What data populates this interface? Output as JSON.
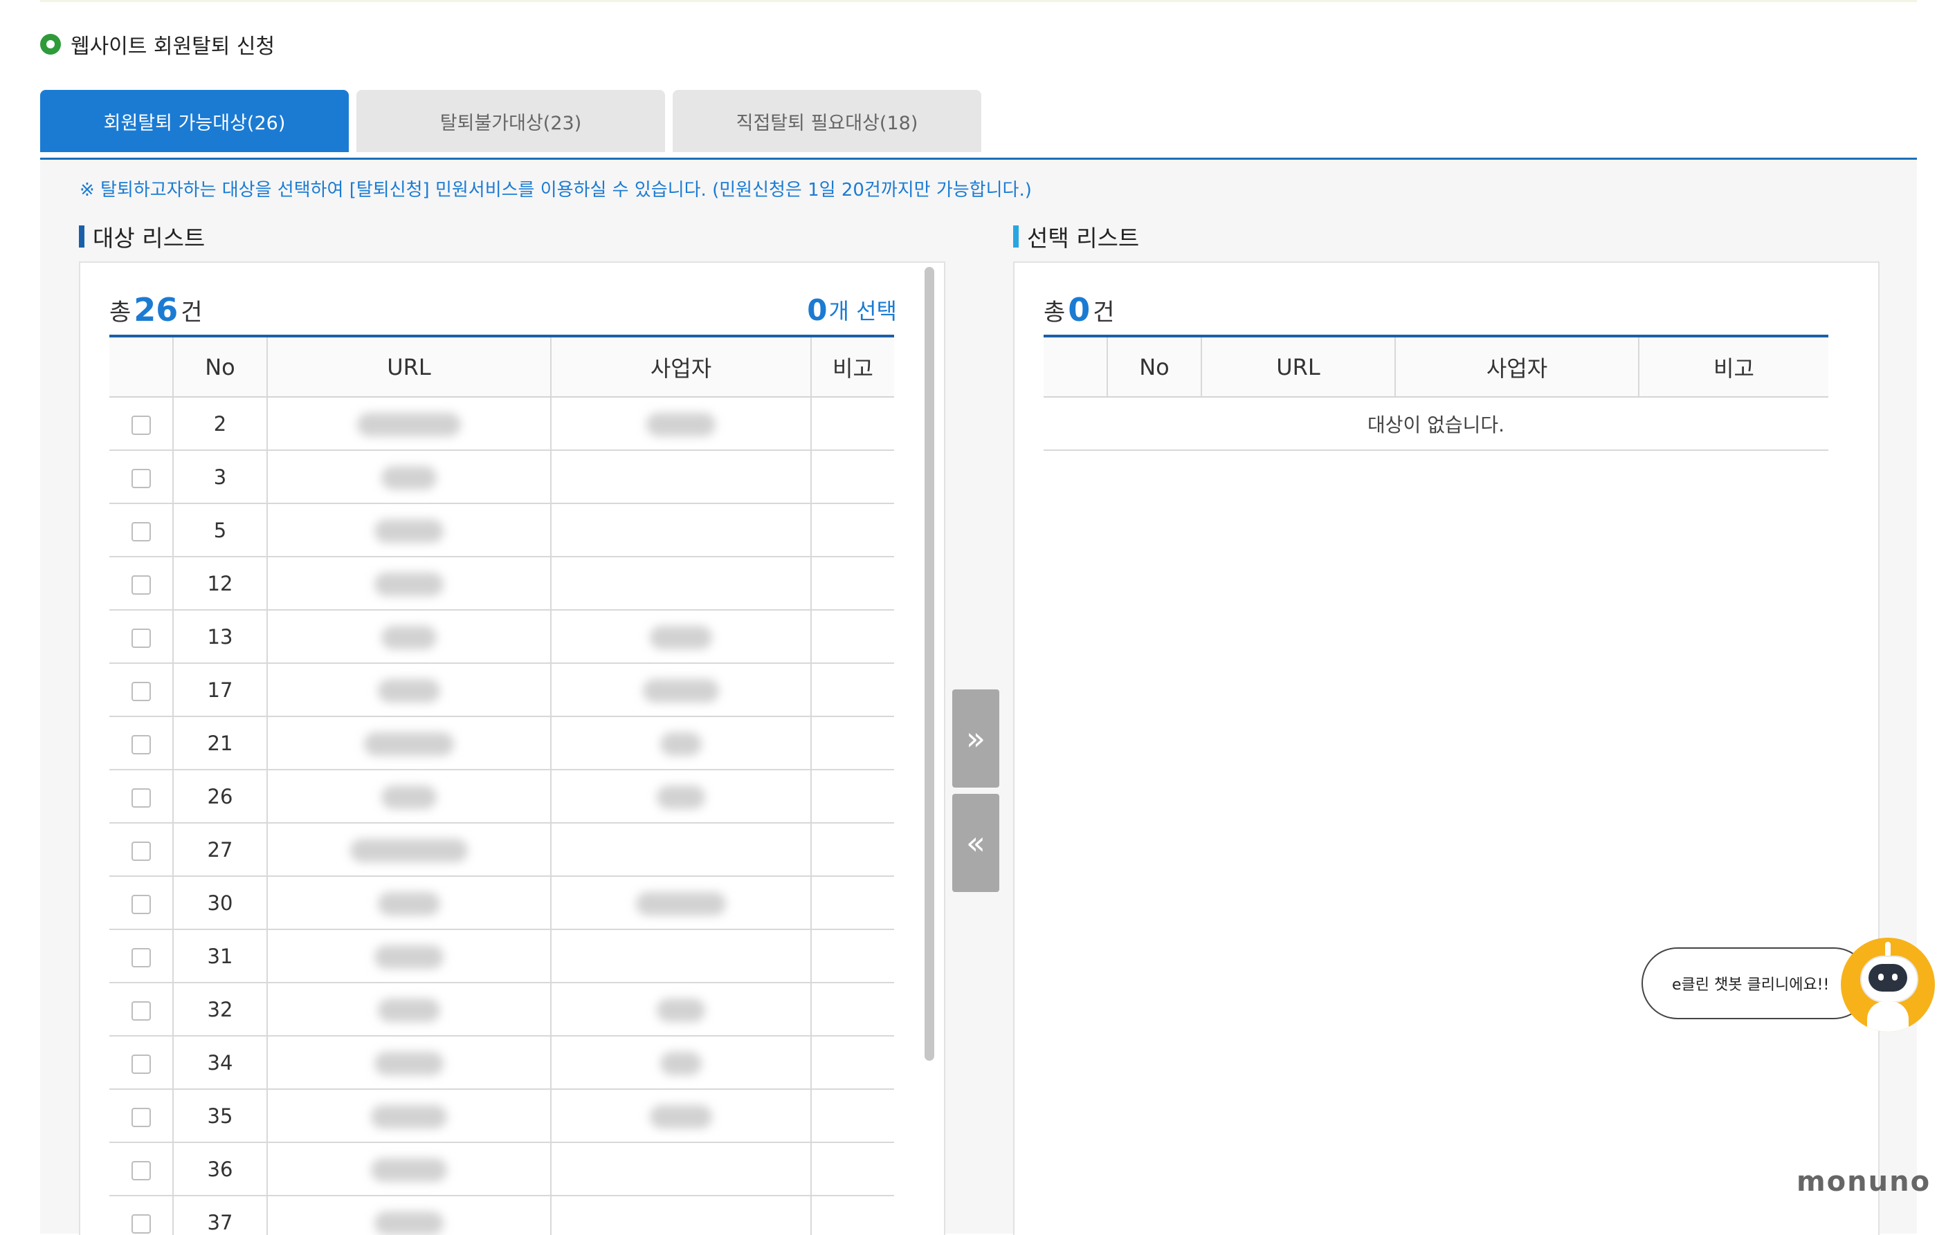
{
  "header": {
    "title": "웹사이트 회원탈퇴 신청"
  },
  "tabs": [
    {
      "label": "회원탈퇴 가능대상(26)",
      "active": true
    },
    {
      "label": "탈퇴불가대상(23)",
      "active": false
    },
    {
      "label": "직접탈퇴 필요대상(18)",
      "active": false
    }
  ],
  "notice": "※ 탈퇴하고자하는 대상을 선택하여 [탈퇴신청] 민원서비스를 이용하실 수 있습니다. (민원신청은 1일 20건까지만 가능합니다.)",
  "colors": {
    "accent": "#1b7bd3",
    "header_border": "#1b5fa8",
    "left_section_bar": "#1b5fa8",
    "right_section_bar": "#29a6e0",
    "move_button": "#a8a8a8",
    "chatbot": "#f7b21a"
  },
  "target_list": {
    "title": "대상 리스트",
    "total_prefix": "총",
    "total_count": "26",
    "total_suffix": "건",
    "selected_count": "0",
    "selected_suffix": "개 선택",
    "columns": [
      "",
      "No",
      "URL",
      "사업자",
      "비고"
    ],
    "rows": [
      {
        "no": "2"
      },
      {
        "no": "3"
      },
      {
        "no": "5"
      },
      {
        "no": "12"
      },
      {
        "no": "13"
      },
      {
        "no": "17"
      },
      {
        "no": "21"
      },
      {
        "no": "26"
      },
      {
        "no": "27"
      },
      {
        "no": "30"
      },
      {
        "no": "31"
      },
      {
        "no": "32"
      },
      {
        "no": "34"
      },
      {
        "no": "35"
      },
      {
        "no": "36"
      },
      {
        "no": "37"
      }
    ]
  },
  "selected_list": {
    "title": "선택 리스트",
    "total_prefix": "총",
    "total_count": "0",
    "total_suffix": "건",
    "columns": [
      "",
      "No",
      "URL",
      "사업자",
      "비고"
    ],
    "empty_message": "대상이 없습니다."
  },
  "buttons": {
    "move_right_icon": "double-chevron-right-icon",
    "move_left_icon": "double-chevron-left-icon"
  },
  "chatbot": {
    "message": "e클린 챗봇 클리니에요!!",
    "icon": "robot-icon"
  },
  "logo": {
    "text": "monuno"
  }
}
